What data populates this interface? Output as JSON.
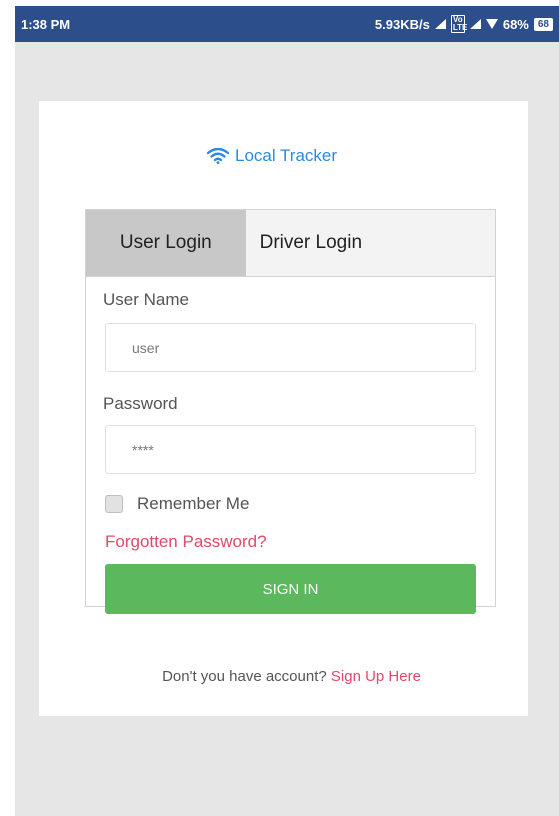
{
  "status_bar": {
    "time": "1:38 PM",
    "network_speed": "5.93KB/s",
    "volte": "Vo\nLTE",
    "battery_percent": "68%",
    "battery_level": "68",
    "icons": [
      "signal-icon",
      "volte-icon",
      "signal-icon",
      "wifi-icon",
      "battery-icon"
    ]
  },
  "brand": {
    "name": "Local Tracker",
    "icon": "wifi-icon",
    "color": "#2a8be0"
  },
  "tabs": [
    {
      "label": "User Login",
      "active": true
    },
    {
      "label": "Driver Login",
      "active": false
    }
  ],
  "form": {
    "username_label": "User Name",
    "username_value": "user",
    "password_label": "Password",
    "password_value": "****",
    "remember_label": "Remember Me",
    "remember_checked": false,
    "forgot_label": "Forgotten Password?",
    "signin_label": "SIGN IN"
  },
  "signup": {
    "prompt": "Don't you have account?",
    "link": "Sign Up Here"
  },
  "colors": {
    "status_bar": "#2c4f8c",
    "accent_link": "#e04a6a",
    "primary_button": "#5cb85c",
    "background": "#e6e6e6"
  }
}
